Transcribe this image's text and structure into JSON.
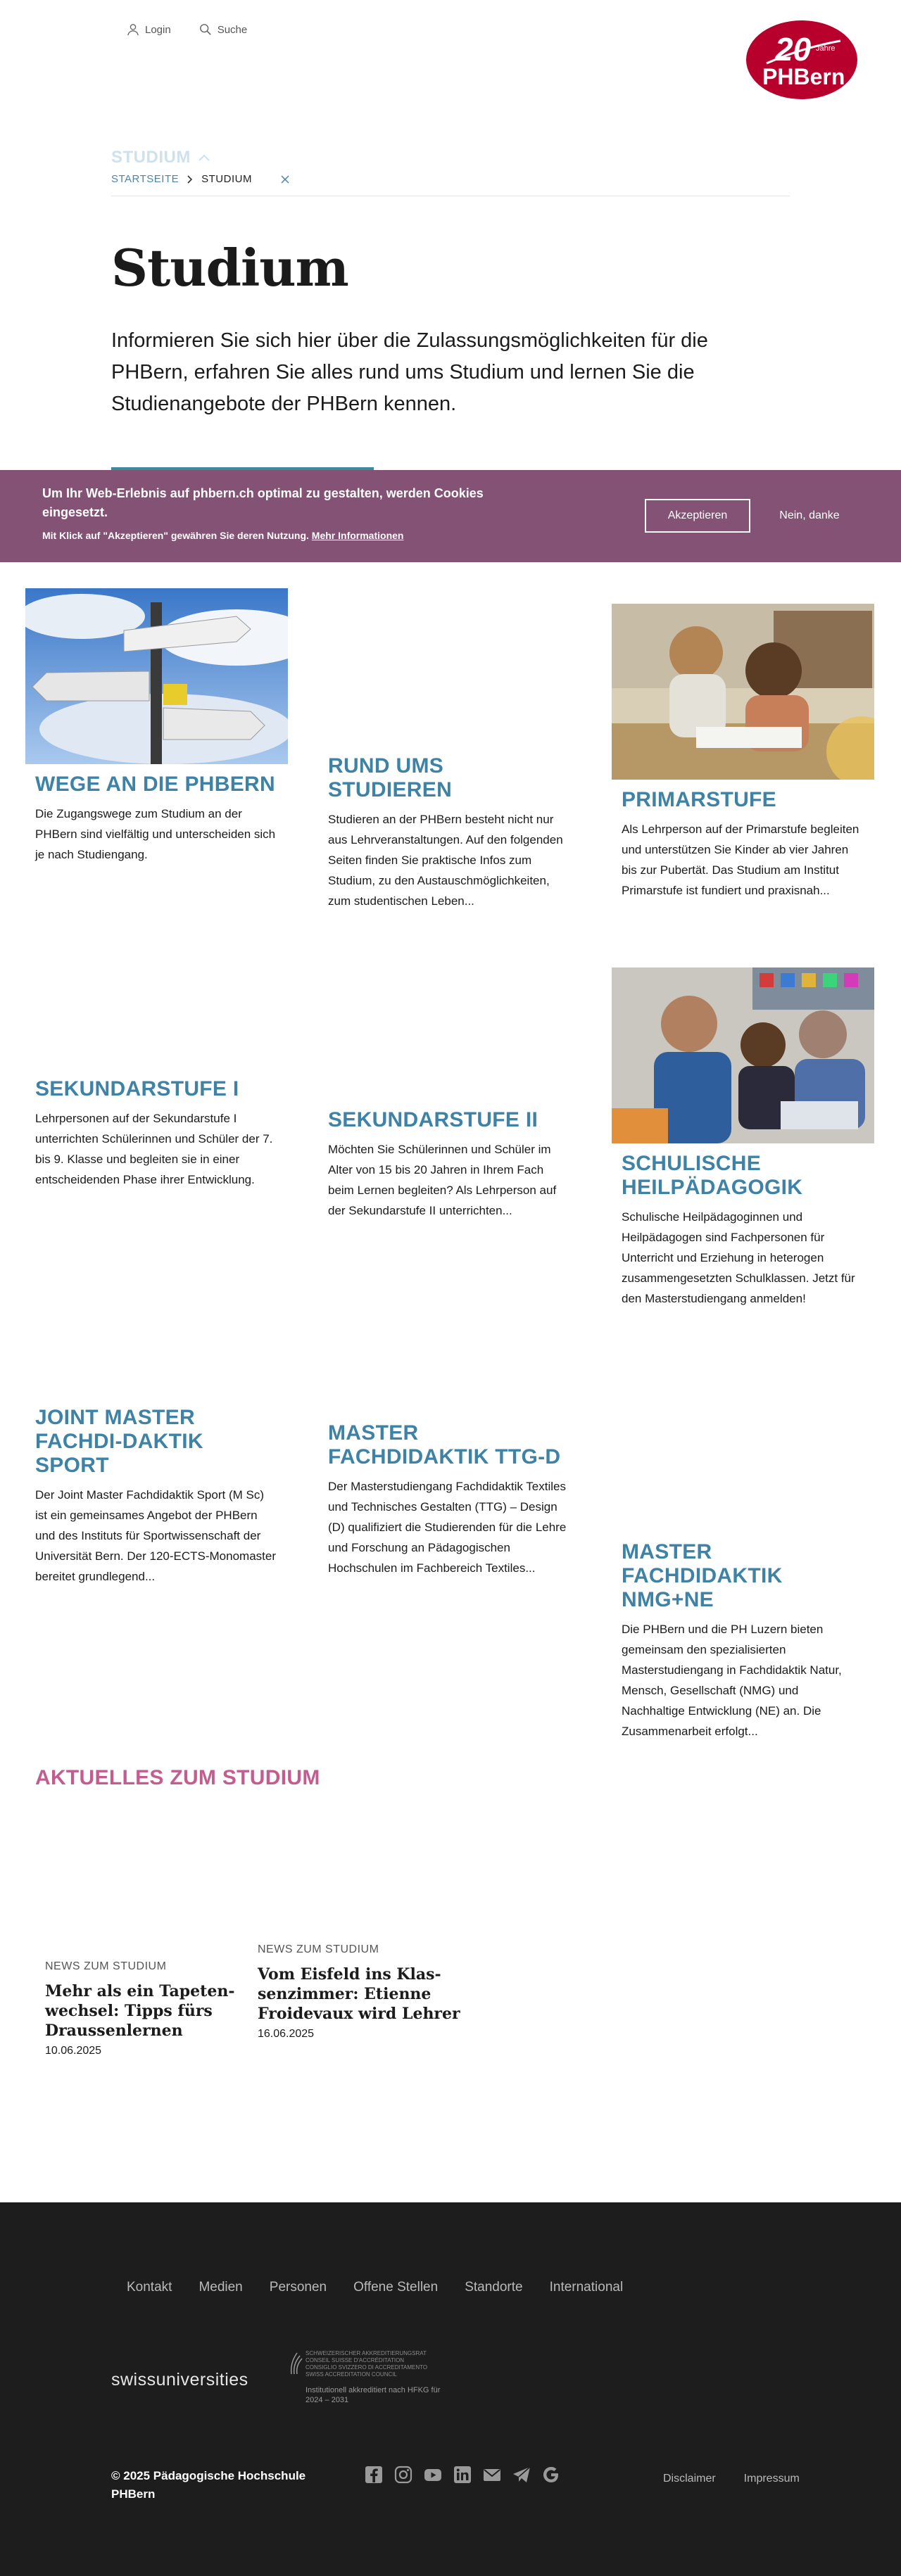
{
  "header": {
    "login_label": "Login",
    "search_label": "Suche",
    "logo": {
      "anniversary": "20",
      "anniversary_word": "Jahre",
      "brand": "PHBern",
      "color": "#b8002d"
    }
  },
  "breadcrumb": {
    "section": "STUDIUM",
    "home": "STARTSEITE",
    "current": "STUDIUM"
  },
  "page": {
    "title": "Studium",
    "lead": "Informieren Sie sich hier über die Zulassungsmöglichkeiten für die PHBern, erfahren Sie alles rund ums Studium und lernen Sie die Studienangebote der PHBern kennen."
  },
  "cookie": {
    "message": "Um Ihr Web-Erlebnis auf phbern.ch optimal zu gestalten, werden Cookies eingesetzt.",
    "sub": "Mit Klick auf \"Akzeptieren\" gewähren Sie deren Nutzung.",
    "more_link": "Mehr Informationen",
    "accept": "Akzeptieren",
    "deny": "Nein, danke",
    "color": "#835275"
  },
  "teasers": [
    {
      "title": "Wege an die PHBern",
      "text": "Die Zugangswege zum Studium an der PHBern sind vielfältig und unterscheiden sich je nach Studiengang."
    },
    {
      "title": "Rund ums Studieren",
      "text": "Studieren an der PHBern besteht nicht nur aus Lehrveranstaltungen. Auf den folgenden Seiten finden Sie praktische Infos zum Studium, zu den Austauschmöglichkeiten, zum studentischen Leben..."
    },
    {
      "title": "Primarstufe",
      "text": "Als Lehrperson auf der Primarstufe begleiten und unterstützen Sie Kinder ab vier Jahren bis zur Pubertät. Das Studium am Institut Primarstufe ist fundiert und praxisnah..."
    },
    {
      "title": "Sekundarstufe I",
      "text": "Lehrpersonen auf der Sekundarstufe I unterrichten Schülerinnen und Schüler der 7. bis 9. Klasse und begleiten sie in einer entscheidenden Phase ihrer Entwicklung."
    },
    {
      "title": "Sekundarstufe II",
      "text": "Möchten Sie Schülerinnen und Schüler im Alter von 15 bis 20 Jahren in Ihrem Fach beim Lernen begleiten? Als Lehrperson auf der Sekundarstufe II unterrichten..."
    },
    {
      "title": "Schulische Heilpädagogik",
      "text": "Schulische Heilpädagoginnen und Heilpädagogen sind Fachpersonen für Unterricht und Erziehung in heterogen zusammengesetzten Schulklassen. Jetzt für den Masterstudiengang anmelden!"
    },
    {
      "title": "Joint Master Fachdi-daktik Sport",
      "text": "Der Joint Master Fachdidaktik Sport (M Sc) ist ein gemeinsames Angebot der PHBern und des Instituts für Sportwissenschaft der Universität Bern. Der 120-ECTS-Monomaster bereitet grundlegend..."
    },
    {
      "title": "Master Fachdidaktik TTG-D",
      "text": "Der Masterstudiengang Fachdidaktik Textiles und Technisches Gestalten (TTG) – Design (D) qualifiziert die Studierenden für die Lehre und Forschung an Pädagogischen Hochschulen im Fachbereich Textiles..."
    },
    {
      "title": "Master Fachdidaktik NMG+NE",
      "text": "Die PHBern und die PH Luzern bieten gemeinsam den spezialisierten Masterstudiengang in Fachdidaktik Natur, Mensch, Gesellschaft (NMG) und Nachhaltige Entwicklung (NE) an. Die Zusammenarbeit erfolgt..."
    }
  ],
  "news": {
    "heading": "Aktuelles zum Studium",
    "items": [
      {
        "kicker": "News zum Studium",
        "title": "Mehr als ein Tapeten-wechsel: Tipps fürs Draussenlernen",
        "date": "10.06.2025"
      },
      {
        "kicker": "News zum Studium",
        "title": "Vom Eisfeld ins Klas-senzimmer: Etienne Froidevaux wird Lehrer",
        "date": "16.06.2025"
      }
    ]
  },
  "footer": {
    "nav": [
      "Kontakt",
      "Medien",
      "Personen",
      "Offene Stellen",
      "Standorte",
      "International"
    ],
    "swissuniversities": "swissuniversities",
    "accreditation_lines": [
      "SCHWEIZERISCHER AKKREDITIERUNGSRAT",
      "CONSEIL SUISSE D'ACCRÉDITATION",
      "CONSIGLIO SVIZZERO DI ACCREDITAMENTO",
      "SWISS ACCREDITATION COUNCIL"
    ],
    "accreditation_caption": "Institutionell akkreditiert nach HFKG für 2024 – 2031",
    "copyright_line1": "© 2025 Pädagogische Hochschule",
    "copyright_line2": "PHBern",
    "socials": [
      "facebook-icon",
      "instagram-icon",
      "youtube-icon",
      "linkedin-icon",
      "mail-icon",
      "newsletter-icon",
      "google-icon"
    ],
    "legal": [
      "Disclaimer",
      "Impressum"
    ]
  }
}
